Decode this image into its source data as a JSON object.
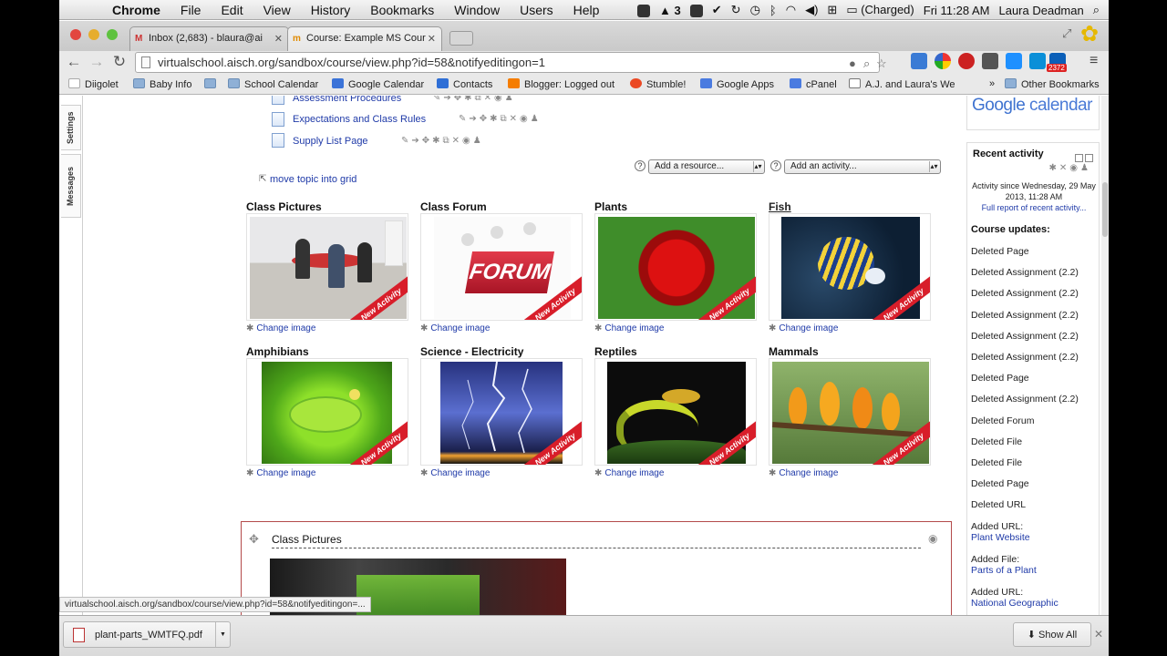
{
  "menubar": {
    "app": "Chrome",
    "items": [
      "File",
      "Edit",
      "View",
      "History",
      "Bookmarks",
      "Window",
      "Users",
      "Help"
    ],
    "tray_badge": "3",
    "battery": "(Charged)",
    "clock": "Fri 11:28 AM",
    "user": "Laura Deadman"
  },
  "tabs": [
    {
      "label": "Inbox (2,683) - blaura@ai",
      "favicon": "M",
      "active": false
    },
    {
      "label": "Course: Example MS Cour",
      "favicon": "m",
      "active": true
    }
  ],
  "toolbar": {
    "url": "virtualschool.aisch.org/sandbox/course/view.php?id=58&notifyeditingon=1",
    "badge": "2372"
  },
  "bookmarks": [
    "Diigolet",
    "Baby Info",
    "School Calendar",
    "Google Calendar",
    "Contacts",
    "Blogger: Logged out",
    "Stumble!",
    "Google Apps",
    "cPanel",
    "A.J. and Laura's We",
    "»",
    "Other Bookmarks"
  ],
  "side_tabs": [
    "Settings",
    "Messages"
  ],
  "activities": [
    "Assessment Procedures",
    "Expectations and Class Rules",
    "Supply List Page"
  ],
  "add_resource": "Add a resource...",
  "add_activity": "Add an activity...",
  "move_topic": "move topic into grid",
  "tiles": [
    {
      "title": "Class Pictures",
      "ribbon": "New Activity",
      "change": "Change image",
      "link": false
    },
    {
      "title": "Class Forum",
      "ribbon": "New Activity",
      "change": "Change image",
      "link": false
    },
    {
      "title": "Plants",
      "ribbon": "New Activity",
      "change": "Change image",
      "link": false
    },
    {
      "title": "Fish",
      "ribbon": "New Activity",
      "change": "Change image",
      "link": true
    },
    {
      "title": "Amphibians",
      "ribbon": "New Activity",
      "change": "Change image",
      "link": false
    },
    {
      "title": "Science - Electricity",
      "ribbon": "New Activity",
      "change": "Change image",
      "link": false
    },
    {
      "title": "Reptiles",
      "ribbon": "New Activity",
      "change": "Change image",
      "link": false
    },
    {
      "title": "Mammals",
      "ribbon": "New Activity",
      "change": "Change image",
      "link": false
    }
  ],
  "forum_image_text": "FORUM",
  "section_title": "Class Pictures",
  "sidebar": {
    "gcal_google": "Google",
    "gcal_calendar": " calendar",
    "recent_title": "Recent activity",
    "since": "Activity since Wednesday, 29 May 2013, 11:28 AM",
    "full_report": "Full report of recent activity...",
    "course_updates": "Course updates:",
    "updates": [
      {
        "text": "Deleted Page"
      },
      {
        "text": "Deleted Assignment (2.2)"
      },
      {
        "text": "Deleted Assignment (2.2)"
      },
      {
        "text": "Deleted Assignment (2.2)"
      },
      {
        "text": "Deleted Assignment (2.2)"
      },
      {
        "text": "Deleted Assignment (2.2)"
      },
      {
        "text": "Deleted Page"
      },
      {
        "text": "Deleted Assignment (2.2)"
      },
      {
        "text": "Deleted Forum"
      },
      {
        "text": "Deleted File"
      },
      {
        "text": "Deleted File"
      },
      {
        "text": "Deleted Page"
      },
      {
        "text": "Deleted URL"
      },
      {
        "text": "Added URL:",
        "link": "Plant Website"
      },
      {
        "text": "Added File:",
        "link": "Parts of a Plant"
      },
      {
        "text": "Added URL:",
        "link": "National Geographic"
      }
    ]
  },
  "status_url": "virtualschool.aisch.org/sandbox/course/view.php?id=58&notifyeditingon=...",
  "download": {
    "file": "plant-parts_WMTFQ.pdf",
    "show_all": "Show All"
  }
}
